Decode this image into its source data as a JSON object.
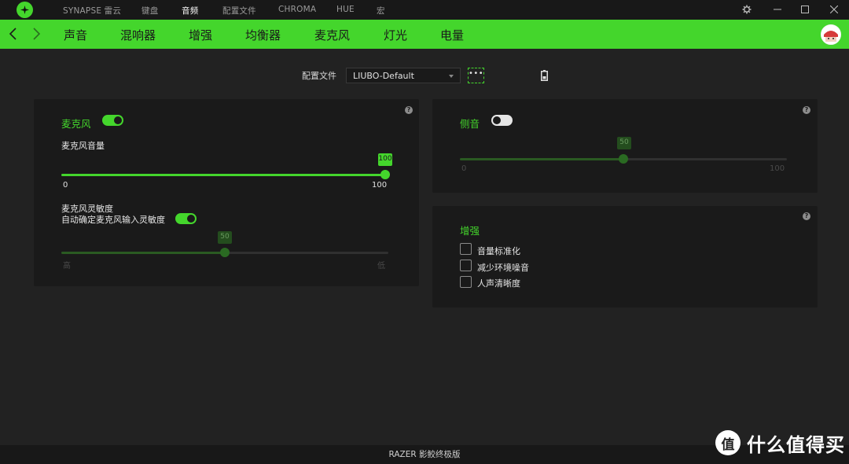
{
  "topbar": {
    "items": [
      "SYNAPSE 雷云",
      "键盘",
      "音频",
      "配置文件",
      "CHROMA",
      "HUE",
      "宏"
    ],
    "active_index": 2
  },
  "subnav": {
    "tabs": [
      "声音",
      "混响器",
      "增强",
      "均衡器",
      "麦克风",
      "灯光",
      "电量"
    ],
    "active_index": 4
  },
  "profile": {
    "label": "配置文件",
    "value": "LIUBO-Default",
    "more_label": "•••"
  },
  "mic_panel": {
    "title": "麦克风",
    "toggle_on": true,
    "volume_label": "麦克风音量",
    "volume_value": "100",
    "volume_level": 1.0,
    "volume_min": "0",
    "volume_max": "100",
    "sensitivity_label": "麦克风灵敏度",
    "auto_label": "自动确定麦克风输入灵敏度",
    "auto_toggle_on": true,
    "sensitivity_value": "50",
    "sensitivity_level": 0.5,
    "sensitivity_low_label": "高",
    "sensitivity_high_label": "低"
  },
  "sidetone_panel": {
    "title": "侧音",
    "toggle_on": false,
    "value": "50",
    "level": 0.5,
    "min": "0",
    "max": "100"
  },
  "enhance_panel": {
    "title": "增强",
    "options": [
      {
        "label": "音量标准化",
        "checked": false
      },
      {
        "label": "减少环境噪音",
        "checked": false
      },
      {
        "label": "人声清晰度",
        "checked": false
      }
    ]
  },
  "help_label": "?",
  "footer": {
    "text": "RAZER 影鲛终极版"
  },
  "watermark": {
    "text": "什么值得买",
    "logo_text": "值"
  },
  "colors": {
    "accent": "#44d62c",
    "background": "#222222",
    "panel": "#1a1a1a"
  }
}
